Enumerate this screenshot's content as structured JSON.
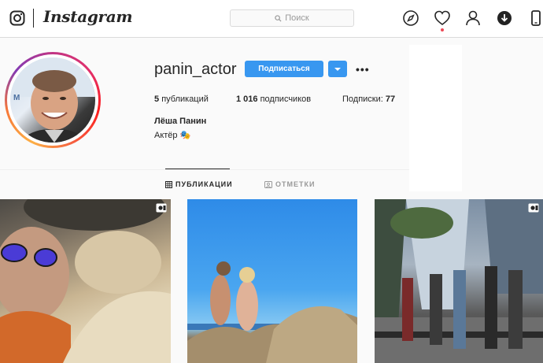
{
  "topbar": {
    "wordmark": "Instagram",
    "search_placeholder": "Поиск",
    "icons": [
      "instagram-glyph",
      "compass-icon",
      "heart-icon",
      "profile-icon",
      "download-icon",
      "phone-icon"
    ],
    "accent_dot_color": "#ed4956"
  },
  "profile": {
    "username": "panin_actor",
    "follow_label": "Подписаться",
    "more_label": "•••",
    "stats": {
      "posts_count": "5",
      "posts_label": "публикаций",
      "followers_count": "1 016",
      "followers_label": "подписчиков",
      "following_label": "Подписки:",
      "following_count": "77"
    },
    "full_name": "Лёша Панин",
    "bio": "Актёр 🎭",
    "button_color": "#3897f0"
  },
  "tabs": [
    {
      "label": "ПУБЛИКАЦИИ",
      "active": true,
      "icon": "grid-icon"
    },
    {
      "label": "ОТМЕТКИ",
      "active": false,
      "icon": "tag-icon"
    }
  ],
  "posts": [
    {
      "type": "video",
      "badge": "video-icon"
    },
    {
      "type": "photo"
    },
    {
      "type": "video",
      "badge": "video-icon"
    }
  ]
}
